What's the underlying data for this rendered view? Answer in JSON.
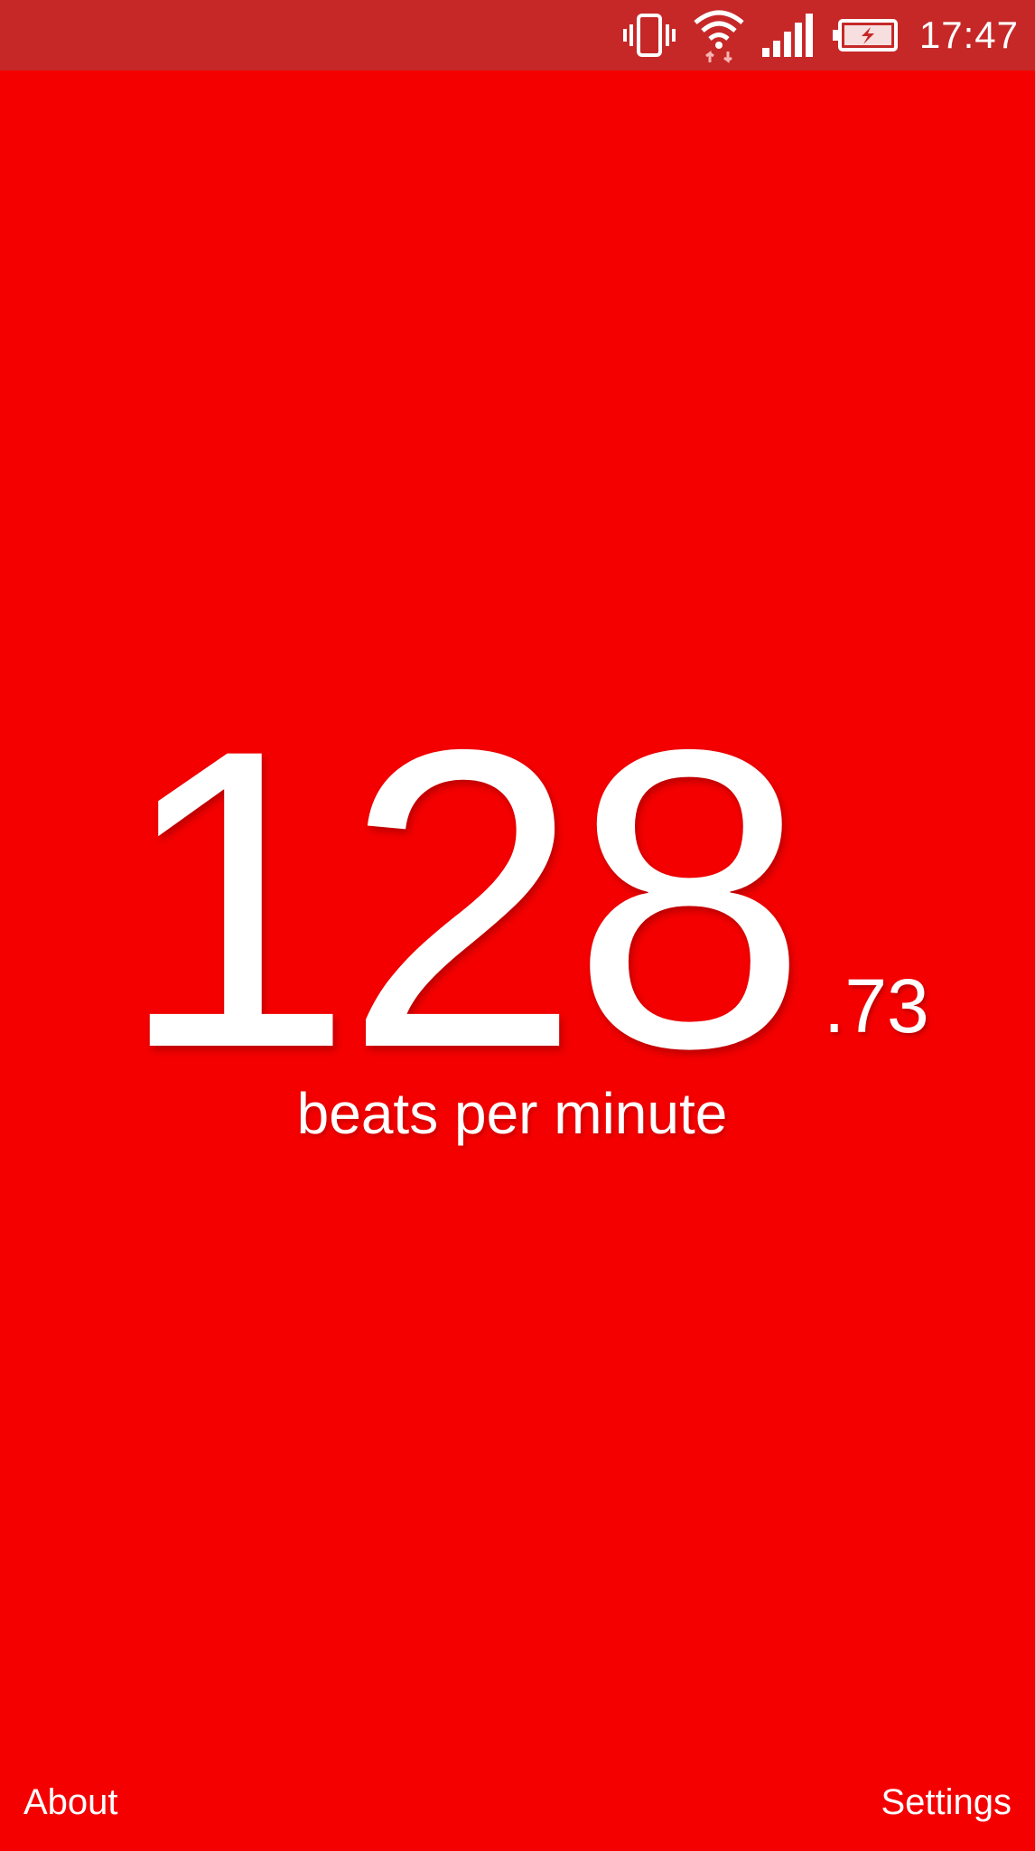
{
  "status_bar": {
    "time": "17:47",
    "icons": [
      "vibrate-icon",
      "wifi-icon",
      "signal-icon",
      "battery-charging-icon"
    ],
    "background_color": "#c62828"
  },
  "tempo": {
    "integer": "128",
    "fraction": ".73",
    "unit_label": "beats per minute"
  },
  "footer": {
    "about_label": "About",
    "settings_label": "Settings"
  },
  "colors": {
    "background": "#f40000",
    "text": "#ffffff"
  }
}
